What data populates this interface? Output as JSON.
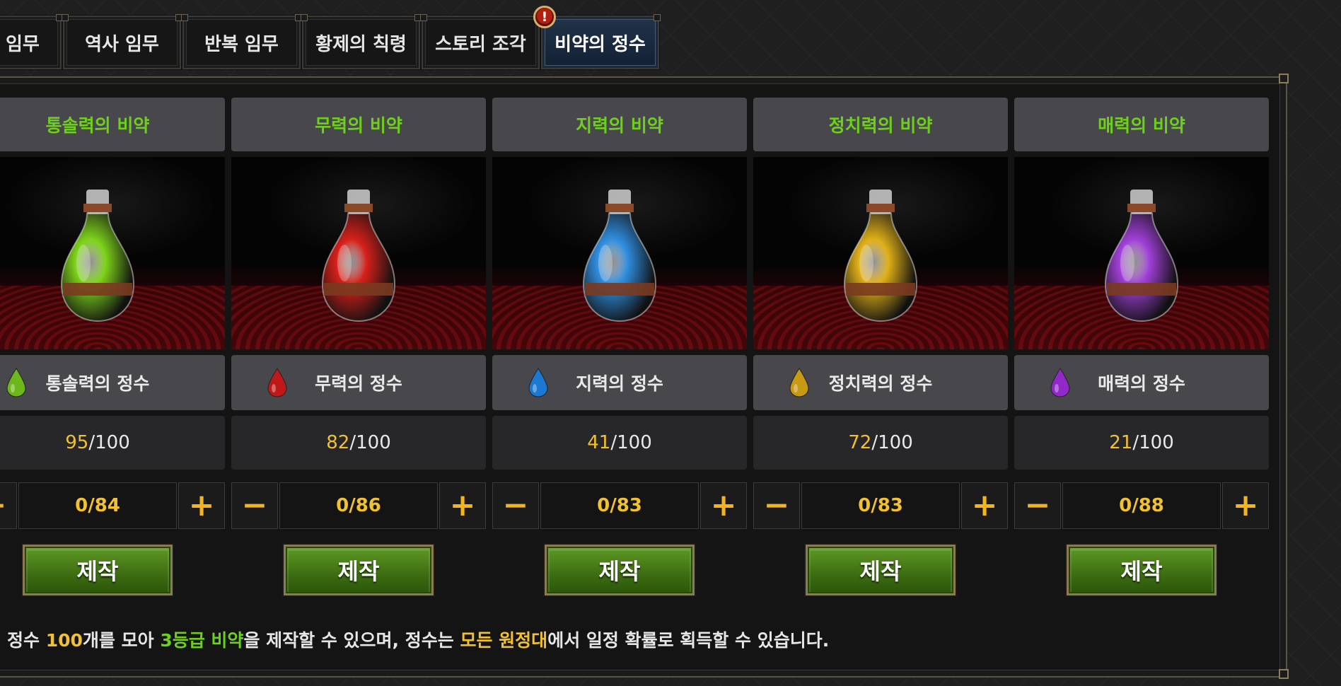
{
  "tabs": [
    {
      "label": "일일 임무",
      "active": false
    },
    {
      "label": "역사 임무",
      "active": false
    },
    {
      "label": "반복 임무",
      "active": false
    },
    {
      "label": "황제의 칙령",
      "active": false
    },
    {
      "label": "스토리 조각",
      "active": false
    },
    {
      "label": "비약의 정수",
      "active": true,
      "alert": "!"
    }
  ],
  "elixirs": [
    {
      "title": "통솔력의 비약",
      "essence": "통솔력의 정수",
      "current": "95",
      "max": "/100",
      "amount": "0/84",
      "make_label": "제작",
      "liquid_color": "#7ed41a",
      "drop_color": "#6cb81a",
      "potion_icon": "green-potion-icon"
    },
    {
      "title": "무력의 비약",
      "essence": "무력의 정수",
      "current": "82",
      "max": "/100",
      "amount": "0/86",
      "make_label": "제작",
      "liquid_color": "#d8201a",
      "drop_color": "#c01818",
      "potion_icon": "red-potion-icon"
    },
    {
      "title": "지력의 비약",
      "essence": "지력의 정수",
      "current": "41",
      "max": "/100",
      "amount": "0/83",
      "make_label": "제작",
      "liquid_color": "#2f8fe0",
      "drop_color": "#1c78d0",
      "potion_icon": "blue-potion-icon"
    },
    {
      "title": "정치력의 비약",
      "essence": "정치력의 정수",
      "current": "72",
      "max": "/100",
      "amount": "0/83",
      "make_label": "제작",
      "liquid_color": "#e0b018",
      "drop_color": "#c89a14",
      "potion_icon": "yellow-potion-icon"
    },
    {
      "title": "매력의 비약",
      "essence": "매력의 정수",
      "current": "21",
      "max": "/100",
      "amount": "0/88",
      "make_label": "제작",
      "liquid_color": "#a040d8",
      "drop_color": "#9128c8",
      "potion_icon": "purple-potion-icon"
    }
  ],
  "stepper": {
    "minus": "−",
    "plus": "+"
  },
  "footnote": {
    "p1": "정수 ",
    "p2": "100",
    "p3": "개를 모아 ",
    "p4": "3등급 비약",
    "p5": "을 제작할 수 있으며, 정수는 ",
    "p6": "모든 원정대",
    "p7": "에서 일정 확률로 획득할 수 있습니다."
  }
}
